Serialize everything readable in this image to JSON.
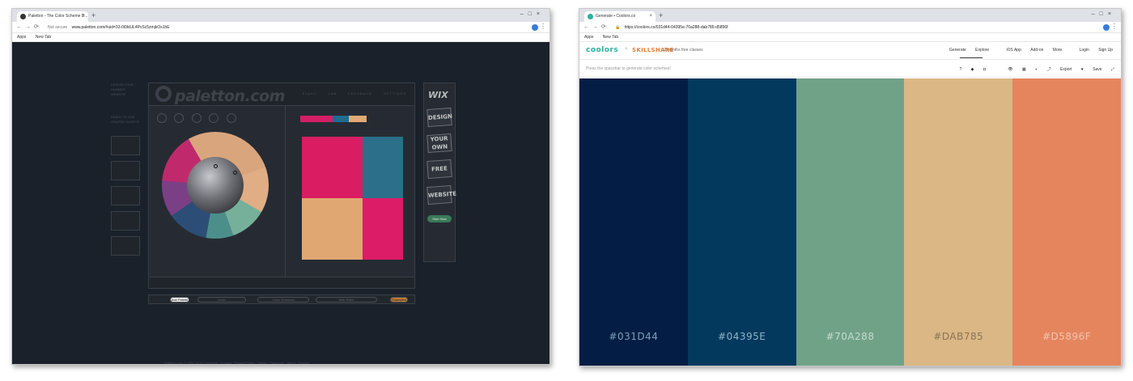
{
  "left_window": {
    "tab_title": "Paletton - The Color Scheme D...",
    "url_prefix": "Not secure",
    "url": "www.paletton.com/#uid=33-0i0kiUL4PvSc5zmjkOs1hE",
    "bookmarks": [
      "Apps",
      "New Tab"
    ],
    "site": {
      "logo": "paletton.com",
      "top_nav": [
        "Export",
        "LAB",
        "FEEDBACK",
        "SETTINGS"
      ],
      "left_promo": "DESIGN YOUR SUMMER WEBSITE",
      "left_label": "READY TO USE GRAPHIC ASSETS",
      "wix_logo": "WIX",
      "wix_blocks": [
        "DESIGN",
        "YOUR OWN",
        "FREE",
        "WEBSITE"
      ],
      "wix_cta": "Start Now",
      "bottom_bar": [
        "Add Palette",
        "Undo",
        "Color Schemes",
        "Web Pallet",
        "Examples"
      ],
      "copyright": "Paletton.com © 2002-2018 Copyright · Contact · Privacy Policy · Twitter · Facebook · About · Hosting"
    }
  },
  "right_window": {
    "tab_title": "Generate • Coolors.co",
    "url": "https://coolors.co/031d44-04395e-70a288-dab785-d5896f",
    "bookmarks": [
      "Apps",
      "New Tab"
    ],
    "site": {
      "logo": "coolors",
      "partner": "SKILLSHARE",
      "promo": "2 months free classes",
      "menu": [
        "Generate",
        "Explore",
        "iOS App",
        "Add-on",
        "More",
        "Login",
        "Sign Up"
      ],
      "hint": "Press the spacebar to generate color schemes!",
      "tools": [
        "Export",
        "Save"
      ],
      "palette": [
        {
          "hex": "#031D44",
          "color": "#031d44",
          "text": "#7aa0b6"
        },
        {
          "hex": "#04395E",
          "color": "#04395e",
          "text": "#8fb3c7"
        },
        {
          "hex": "#70A288",
          "color": "#70a288",
          "text": "#c5dbcd"
        },
        {
          "hex": "#DAB785",
          "color": "#dab785",
          "text": "#8a7458"
        },
        {
          "hex": "#D5896F",
          "color": "#e5855e",
          "text": "#f3c4b0"
        }
      ]
    }
  }
}
